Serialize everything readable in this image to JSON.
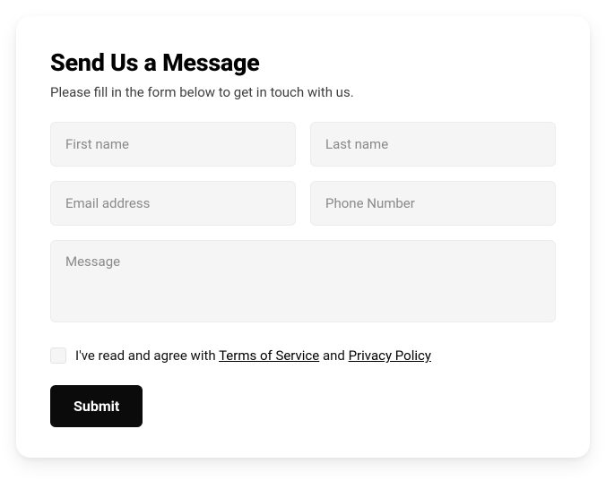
{
  "form": {
    "title": "Send Us a Message",
    "subtitle": "Please fill in the form below to get in touch with us.",
    "fields": {
      "first_name": {
        "placeholder": "First name",
        "value": ""
      },
      "last_name": {
        "placeholder": "Last name",
        "value": ""
      },
      "email": {
        "placeholder": "Email address",
        "value": ""
      },
      "phone": {
        "placeholder": "Phone Number",
        "value": ""
      },
      "message": {
        "placeholder": "Message",
        "value": ""
      }
    },
    "agreement": {
      "prefix": "I've read and agree with ",
      "terms_label": "Terms of Service",
      "middle": " and ",
      "privacy_label": "Privacy Policy",
      "checked": false
    },
    "submit_label": "Submit"
  }
}
